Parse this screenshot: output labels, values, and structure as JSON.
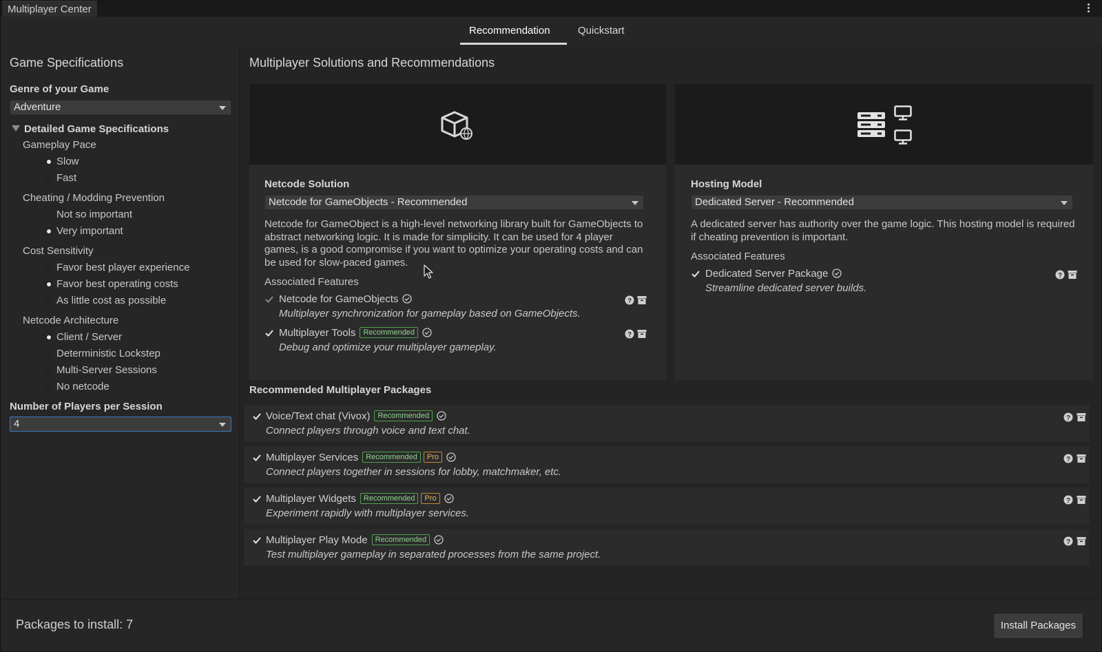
{
  "window": {
    "title": "Multiplayer Center"
  },
  "tabs": [
    {
      "label": "Recommendation",
      "active": true
    },
    {
      "label": "Quickstart",
      "active": false
    }
  ],
  "specs": {
    "heading": "Game Specifications",
    "genre_label": "Genre of your Game",
    "genre_value": "Adventure",
    "foldout_label": "Detailed Game Specifications",
    "groups": [
      {
        "label": "Gameplay Pace",
        "options": [
          {
            "label": "Slow",
            "selected": true
          },
          {
            "label": "Fast",
            "selected": false
          }
        ]
      },
      {
        "label": "Cheating / Modding Prevention",
        "options": [
          {
            "label": "Not so important",
            "selected": false
          },
          {
            "label": "Very important",
            "selected": true
          }
        ]
      },
      {
        "label": "Cost Sensitivity",
        "options": [
          {
            "label": "Favor best player experience",
            "selected": false
          },
          {
            "label": "Favor best operating costs",
            "selected": true
          },
          {
            "label": "As little cost as possible",
            "selected": false
          }
        ]
      },
      {
        "label": "Netcode Architecture",
        "options": [
          {
            "label": "Client / Server",
            "selected": true
          },
          {
            "label": "Deterministic Lockstep",
            "selected": false
          },
          {
            "label": "Multi-Server Sessions",
            "selected": false
          },
          {
            "label": "No netcode",
            "selected": false
          }
        ]
      }
    ],
    "players_label": "Number of Players per Session",
    "players_value": "4"
  },
  "solutions": {
    "heading": "Multiplayer Solutions and Recommendations",
    "netcode": {
      "title": "Netcode Solution",
      "selected": "Netcode for GameObjects - Recommended",
      "description": "Netcode for GameObject is a high-level networking library built for GameObjects to abstract networking logic. It is made for simplicity. It can be used for 4 player games, is a good compromise if you want to optimize your operating costs and can be used for slow-paced games.",
      "features_label": "Associated Features",
      "features": [
        {
          "name": "Netcode for GameObjects",
          "description": "Multiplayer synchronization for gameplay based on GameObjects.",
          "checked": true,
          "recommended": false
        },
        {
          "name": "Multiplayer Tools",
          "description": "Debug and optimize your multiplayer gameplay.",
          "checked": true,
          "recommended": true
        }
      ]
    },
    "hosting": {
      "title": "Hosting Model",
      "selected": "Dedicated Server - Recommended",
      "description": "A dedicated server has authority over the game logic. This hosting model is required if cheating prevention is important.",
      "features_label": "Associated Features",
      "features": [
        {
          "name": "Dedicated Server Package",
          "description": "Streamline dedicated server builds.",
          "checked": true
        }
      ]
    }
  },
  "packages": {
    "heading": "Recommended Multiplayer Packages",
    "badge_recommended": "Recommended",
    "badge_pro": "Pro",
    "items": [
      {
        "name": "Voice/Text chat (Vivox)",
        "description": "Connect players through voice and text chat.",
        "recommended": true,
        "pro": false
      },
      {
        "name": "Multiplayer Services",
        "description": "Connect players together in sessions for lobby, matchmaker, etc.",
        "recommended": true,
        "pro": true
      },
      {
        "name": "Multiplayer Widgets",
        "description": "Experiment rapidly with multiplayer services.",
        "recommended": true,
        "pro": true
      },
      {
        "name": "Multiplayer Play Mode",
        "description": "Test multiplayer gameplay in separated processes from the same project.",
        "recommended": true,
        "pro": false
      }
    ]
  },
  "footer": {
    "packages_count_text": "Packages to install: 7",
    "install_button": "Install Packages"
  },
  "colors": {
    "accent_focus": "#3a79bb",
    "badge_recommended": "#4ea34e",
    "badge_pro": "#c78a34"
  },
  "icons": [
    "kebab-menu-icon",
    "cube-network-icon",
    "server-rack-icon",
    "monitor-icon",
    "check-icon",
    "installed-check-icon",
    "help-icon",
    "package-icon",
    "mouse-cursor-icon"
  ]
}
